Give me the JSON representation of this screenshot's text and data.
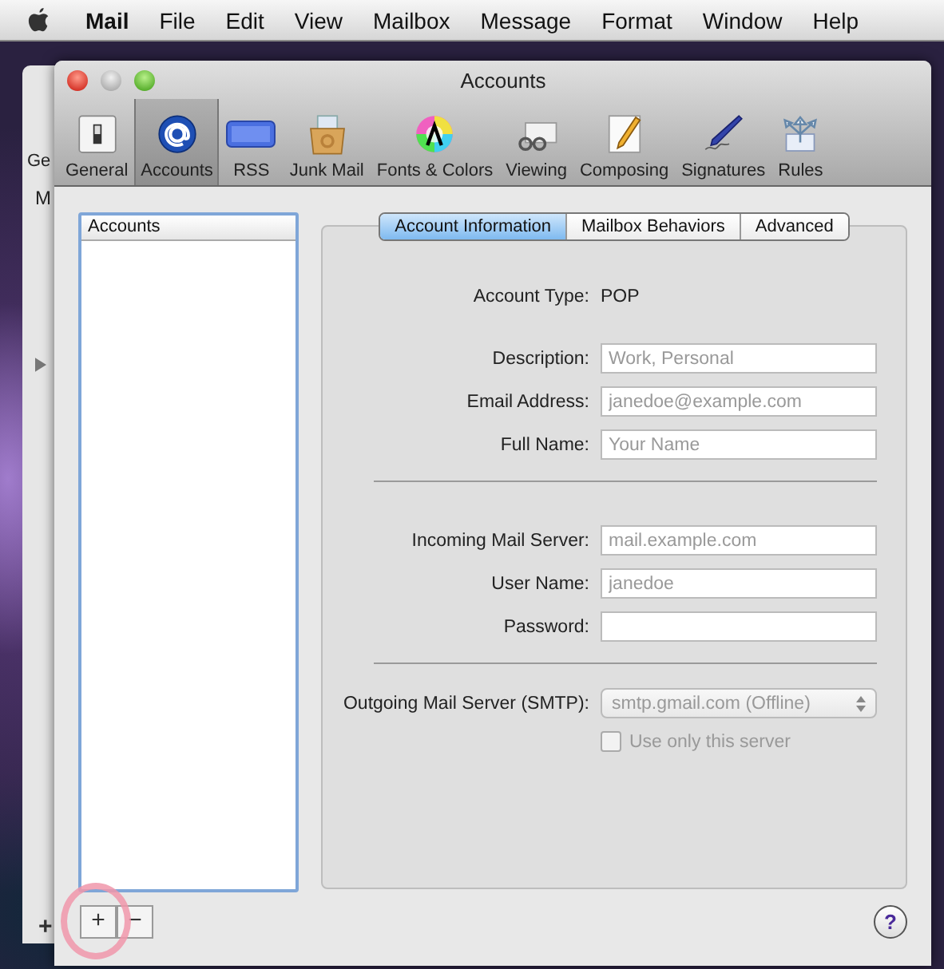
{
  "menu_bar": {
    "app_name": "Mail",
    "items": [
      "File",
      "Edit",
      "View",
      "Mailbox",
      "Message",
      "Format",
      "Window",
      "Help"
    ]
  },
  "back_window": {
    "labels": [
      "Ge",
      "M"
    ],
    "add_button": "+"
  },
  "window": {
    "title": "Accounts"
  },
  "toolbar": [
    {
      "label": "General",
      "selected": false
    },
    {
      "label": "Accounts",
      "selected": true
    },
    {
      "label": "RSS",
      "selected": false
    },
    {
      "label": "Junk Mail",
      "selected": false
    },
    {
      "label": "Fonts & Colors",
      "selected": false
    },
    {
      "label": "Viewing",
      "selected": false
    },
    {
      "label": "Composing",
      "selected": false
    },
    {
      "label": "Signatures",
      "selected": false
    },
    {
      "label": "Rules",
      "selected": false
    }
  ],
  "accounts_list": {
    "header": "Accounts",
    "add_button": "+",
    "remove_button": "−"
  },
  "tabs": [
    {
      "label": "Account Information",
      "selected": true
    },
    {
      "label": "Mailbox Behaviors",
      "selected": false
    },
    {
      "label": "Advanced",
      "selected": false
    }
  ],
  "account_type": {
    "label": "Account Type:",
    "value": "POP"
  },
  "field_groups": [
    [
      {
        "label": "Description:",
        "placeholder": "Work, Personal"
      },
      {
        "label": "Email Address:",
        "placeholder": "janedoe@example.com"
      },
      {
        "label": "Full Name:",
        "placeholder": "Your Name"
      }
    ],
    [
      {
        "label": "Incoming Mail Server:",
        "placeholder": "mail.example.com"
      },
      {
        "label": "User Name:",
        "placeholder": "janedoe"
      },
      {
        "label": "Password:"
      }
    ]
  ],
  "outgoing": {
    "label": "Outgoing Mail Server (SMTP):",
    "value": "smtp.gmail.com (Offline)",
    "disabled": true
  },
  "use_only_server": {
    "label": "Use only this server",
    "checked": false,
    "disabled": true
  },
  "help_button": "?"
}
